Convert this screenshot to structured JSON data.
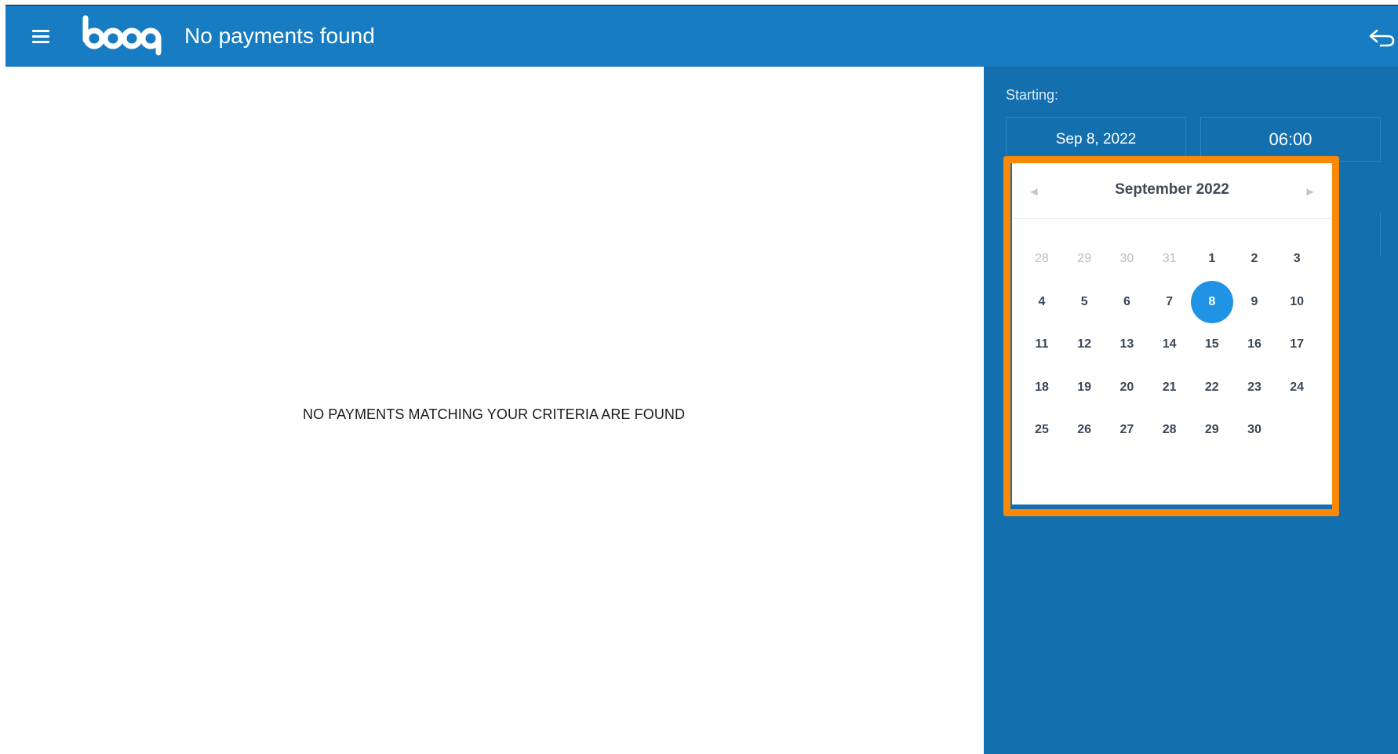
{
  "header": {
    "title": "No payments found",
    "logo_text": "booq"
  },
  "main": {
    "empty_message": "NO PAYMENTS MATCHING YOUR CRITERIA ARE FOUND"
  },
  "filter": {
    "starting_label": "Starting:",
    "date_value": "Sep 8, 2022",
    "time_value": "06:00"
  },
  "calendar": {
    "month_title": "September 2022",
    "prev_icon": "chevron-left-icon",
    "next_icon": "chevron-right-icon",
    "selected_day": "8",
    "weeks": [
      [
        {
          "d": "28",
          "m": true
        },
        {
          "d": "29",
          "m": true
        },
        {
          "d": "30",
          "m": true
        },
        {
          "d": "31",
          "m": true
        },
        {
          "d": "1"
        },
        {
          "d": "2"
        },
        {
          "d": "3"
        }
      ],
      [
        {
          "d": "4"
        },
        {
          "d": "5"
        },
        {
          "d": "6"
        },
        {
          "d": "7"
        },
        {
          "d": "8",
          "s": true
        },
        {
          "d": "9"
        },
        {
          "d": "10"
        }
      ],
      [
        {
          "d": "11"
        },
        {
          "d": "12"
        },
        {
          "d": "13"
        },
        {
          "d": "14"
        },
        {
          "d": "15"
        },
        {
          "d": "16"
        },
        {
          "d": "17"
        }
      ],
      [
        {
          "d": "18"
        },
        {
          "d": "19"
        },
        {
          "d": "20"
        },
        {
          "d": "21"
        },
        {
          "d": "22"
        },
        {
          "d": "23"
        },
        {
          "d": "24"
        }
      ],
      [
        {
          "d": "25"
        },
        {
          "d": "26"
        },
        {
          "d": "27"
        },
        {
          "d": "28"
        },
        {
          "d": "29"
        },
        {
          "d": "30"
        }
      ]
    ]
  },
  "colors": {
    "topbar": "#177cc1",
    "sidebar": "#136fae",
    "selected_day": "#2193e4",
    "highlight": "#fb8806"
  },
  "icons": {
    "menu": "menu-icon",
    "back": "undo-back-icon"
  }
}
